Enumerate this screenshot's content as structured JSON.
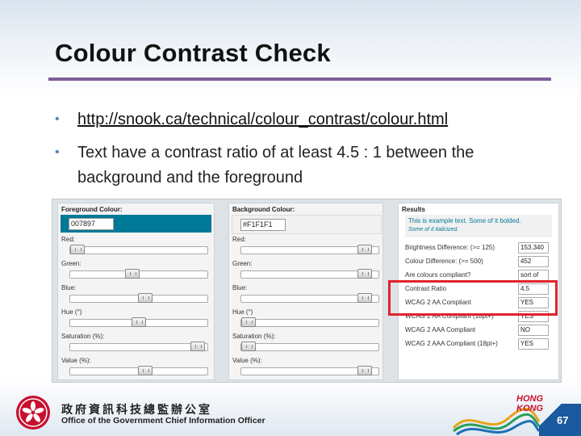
{
  "slide": {
    "title": "Colour Contrast Check",
    "bullets": [
      {
        "text": "http://snook.ca/technical/colour_contrast/colour.html"
      },
      {
        "line1": "Text have a contrast ratio of at least 4.5 : 1 between the",
        "line2": "background and the foreground"
      }
    ]
  },
  "tool": {
    "foreground": {
      "title": "Foreground Colour:",
      "hex": "007897",
      "swatch_color": "#007897",
      "controls": [
        {
          "label": "Red:",
          "level": 0.0
        },
        {
          "label": "Green:",
          "level": 0.45
        },
        {
          "label": "Blue:",
          "level": 0.55
        },
        {
          "label": "Hue (°)",
          "level": 0.5
        },
        {
          "label": "Saturation (%):",
          "level": 0.98
        },
        {
          "label": "Value (%):",
          "level": 0.55
        }
      ]
    },
    "background": {
      "title": "Background Colour:",
      "hex": "#F1F1F1",
      "swatch_color": "#f1f1f1",
      "controls": [
        {
          "label": "Red:",
          "level": 0.95
        },
        {
          "label": "Green:",
          "level": 0.95
        },
        {
          "label": "Blue:",
          "level": 0.95
        },
        {
          "label": "Hue (°)",
          "level": 0.0
        },
        {
          "label": "Saturation (%):",
          "level": 0.0
        },
        {
          "label": "Value (%):",
          "level": 0.95
        }
      ]
    },
    "results": {
      "title": "Results",
      "sample_line1": "This is example text. Some of it bolded.",
      "sample_line2": "Some of it italicized.",
      "rows": [
        {
          "label": "Brightness Difference: (>= 125)",
          "value": "153.340"
        },
        {
          "label": "Colour Difference: (>= 500)",
          "value": "452"
        },
        {
          "label": "Are colours compliant?",
          "value": "sort of"
        },
        {
          "label": "Contrast Ratio",
          "value": "4.5"
        },
        {
          "label": "WCAG 2 AA Compliant",
          "value": "YES"
        },
        {
          "label": "WCAG 2 AA Compliant (18pt+)",
          "value": "YES"
        },
        {
          "label": "WCAG 2 AAA Compliant",
          "value": "NO"
        },
        {
          "label": "WCAG 2 AAA Compliant (18pt+)",
          "value": "YES"
        }
      ]
    }
  },
  "footer": {
    "org_cn": "政府資訊科技總監辦公室",
    "org_en": "Office of the Government Chief Information Officer",
    "hk_line1": "HONG",
    "hk_line2": "KONG",
    "page_number": "67"
  },
  "colors": {
    "title_rule": "#7e5d9a",
    "bullet": "#5a86b8",
    "highlight": "#e0232b",
    "emblem": "#c8102e"
  }
}
